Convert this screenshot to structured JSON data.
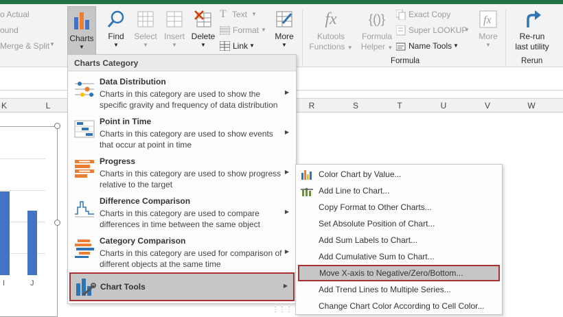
{
  "ribbon": {
    "left_items": [
      "o Actual",
      "ound",
      "Merge & Split"
    ],
    "charts": {
      "label": "Charts"
    },
    "find": {
      "label": "Find"
    },
    "select": {
      "label": "Select"
    },
    "insert": {
      "label": "Insert"
    },
    "delete": {
      "label": "Delete"
    },
    "text": {
      "label": "Text"
    },
    "format": {
      "label": "Format"
    },
    "link": {
      "label": "Link"
    },
    "more": {
      "label": "More"
    },
    "kutools_functions": {
      "line1": "Kutools",
      "line2": "Functions"
    },
    "formula_helper": {
      "line1": "Formula",
      "line2": "Helper"
    },
    "exact_copy": {
      "label": "Exact Copy"
    },
    "super_lookup": {
      "label": "Super LOOKUP"
    },
    "name_tools": {
      "label": "Name Tools"
    },
    "more2": {
      "label": "More"
    },
    "rerun": {
      "line1": "Re-run",
      "line2": "last utility"
    },
    "group_formula": "Formula",
    "group_rerun": "Rerun"
  },
  "columns": [
    "K",
    "L",
    "R",
    "S",
    "T",
    "U",
    "V",
    "W"
  ],
  "chart_axis": [
    "I",
    "J"
  ],
  "charts_menu": {
    "header": "Charts Category",
    "categories": [
      {
        "title": "Data Distribution",
        "desc": "Charts in this category are used to show the specific gravity and frequency of data distribution"
      },
      {
        "title": "Point in Time",
        "desc": "Charts in this category are used to show events that occur at point in time"
      },
      {
        "title": "Progress",
        "desc": "Charts in this category are used to show progress relative to the target"
      },
      {
        "title": "Difference Comparison",
        "desc": "Charts in this category are used to compare differences in time between the same object"
      },
      {
        "title": "Category Comparison",
        "desc": "Charts in this category are used for comparison of different objects at the same time"
      }
    ],
    "chart_tools": "Chart Tools"
  },
  "submenu": {
    "items": [
      "Color Chart by Value...",
      "Add Line to Chart...",
      "Copy Format to Other Charts...",
      "Set Absolute Position of Chart...",
      "Add Sum Labels to Chart...",
      "Add Cumulative Sum to Chart...",
      "Move X-axis to Negative/Zero/Bottom...",
      "Add Trend Lines to Multiple Series...",
      "Change Chart Color According to Cell Color..."
    ],
    "highlighted_index": 6
  },
  "colors": {
    "accent_green": "#217346",
    "highlight_border": "#a83232",
    "bar_blue": "#4472c4",
    "hover_gray": "#c6c6c6"
  }
}
